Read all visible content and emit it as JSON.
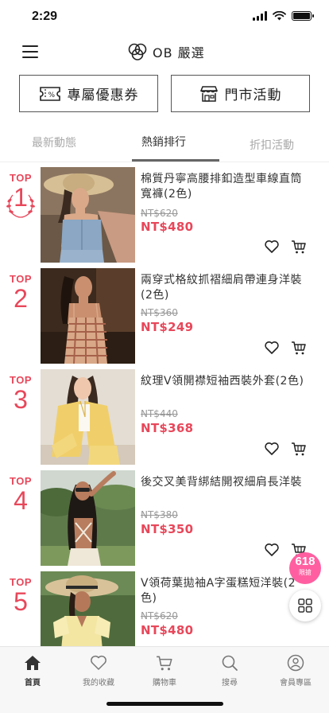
{
  "status_bar": {
    "time": "2:29",
    "icons": [
      "signal-icon",
      "wifi-icon",
      "battery-icon"
    ]
  },
  "header": {
    "brand": "OB 嚴選",
    "menu_icon": "hamburger-icon",
    "logo_icon": "clover-logo-icon"
  },
  "actions": {
    "coupon": {
      "label": "專屬優惠券",
      "icon": "coupon-ticket-icon"
    },
    "store": {
      "label": "門市活動",
      "icon": "storefront-icon"
    }
  },
  "tabs": [
    {
      "label": "最新動態",
      "active": false
    },
    {
      "label": "熱銷排行",
      "active": true
    },
    {
      "label": "折扣活動",
      "active": false
    }
  ],
  "products": [
    {
      "rank_label": "TOP",
      "rank": "1",
      "name": "棉質丹寧高腰排釦造型車線直筒寬褲(2色)",
      "original_price": "NT$620",
      "price": "NT$480"
    },
    {
      "rank_label": "TOP",
      "rank": "2",
      "name": "兩穿式格紋抓褶細肩帶連身洋裝(2色)",
      "original_price": "NT$360",
      "price": "NT$249"
    },
    {
      "rank_label": "TOP",
      "rank": "3",
      "name": "紋理V領開襟短袖西裝外套(2色)",
      "original_price": "NT$440",
      "price": "NT$368"
    },
    {
      "rank_label": "TOP",
      "rank": "4",
      "name": "後交叉美背綁結開衩細肩長洋裝",
      "original_price": "NT$380",
      "price": "NT$350"
    },
    {
      "rank_label": "TOP",
      "rank": "5",
      "name": "V領荷葉拋袖A字蛋糕短洋裝(2色)",
      "original_price": "NT$620",
      "price": "NT$480"
    }
  ],
  "floating": {
    "promo_number": "618",
    "promo_label": "限搶",
    "grid_icon": "grid-icon"
  },
  "bottom_nav": [
    {
      "label": "首頁",
      "icon": "home-icon",
      "active": true
    },
    {
      "label": "我的收藏",
      "icon": "heart-icon",
      "active": false
    },
    {
      "label": "購物車",
      "icon": "cart-icon",
      "active": false
    },
    {
      "label": "搜尋",
      "icon": "search-icon",
      "active": false
    },
    {
      "label": "會員專區",
      "icon": "member-icon",
      "active": false
    }
  ],
  "colors": {
    "accent": "#e8475a",
    "promo": "#ff5fa0",
    "text": "#333333",
    "muted": "#999999"
  }
}
